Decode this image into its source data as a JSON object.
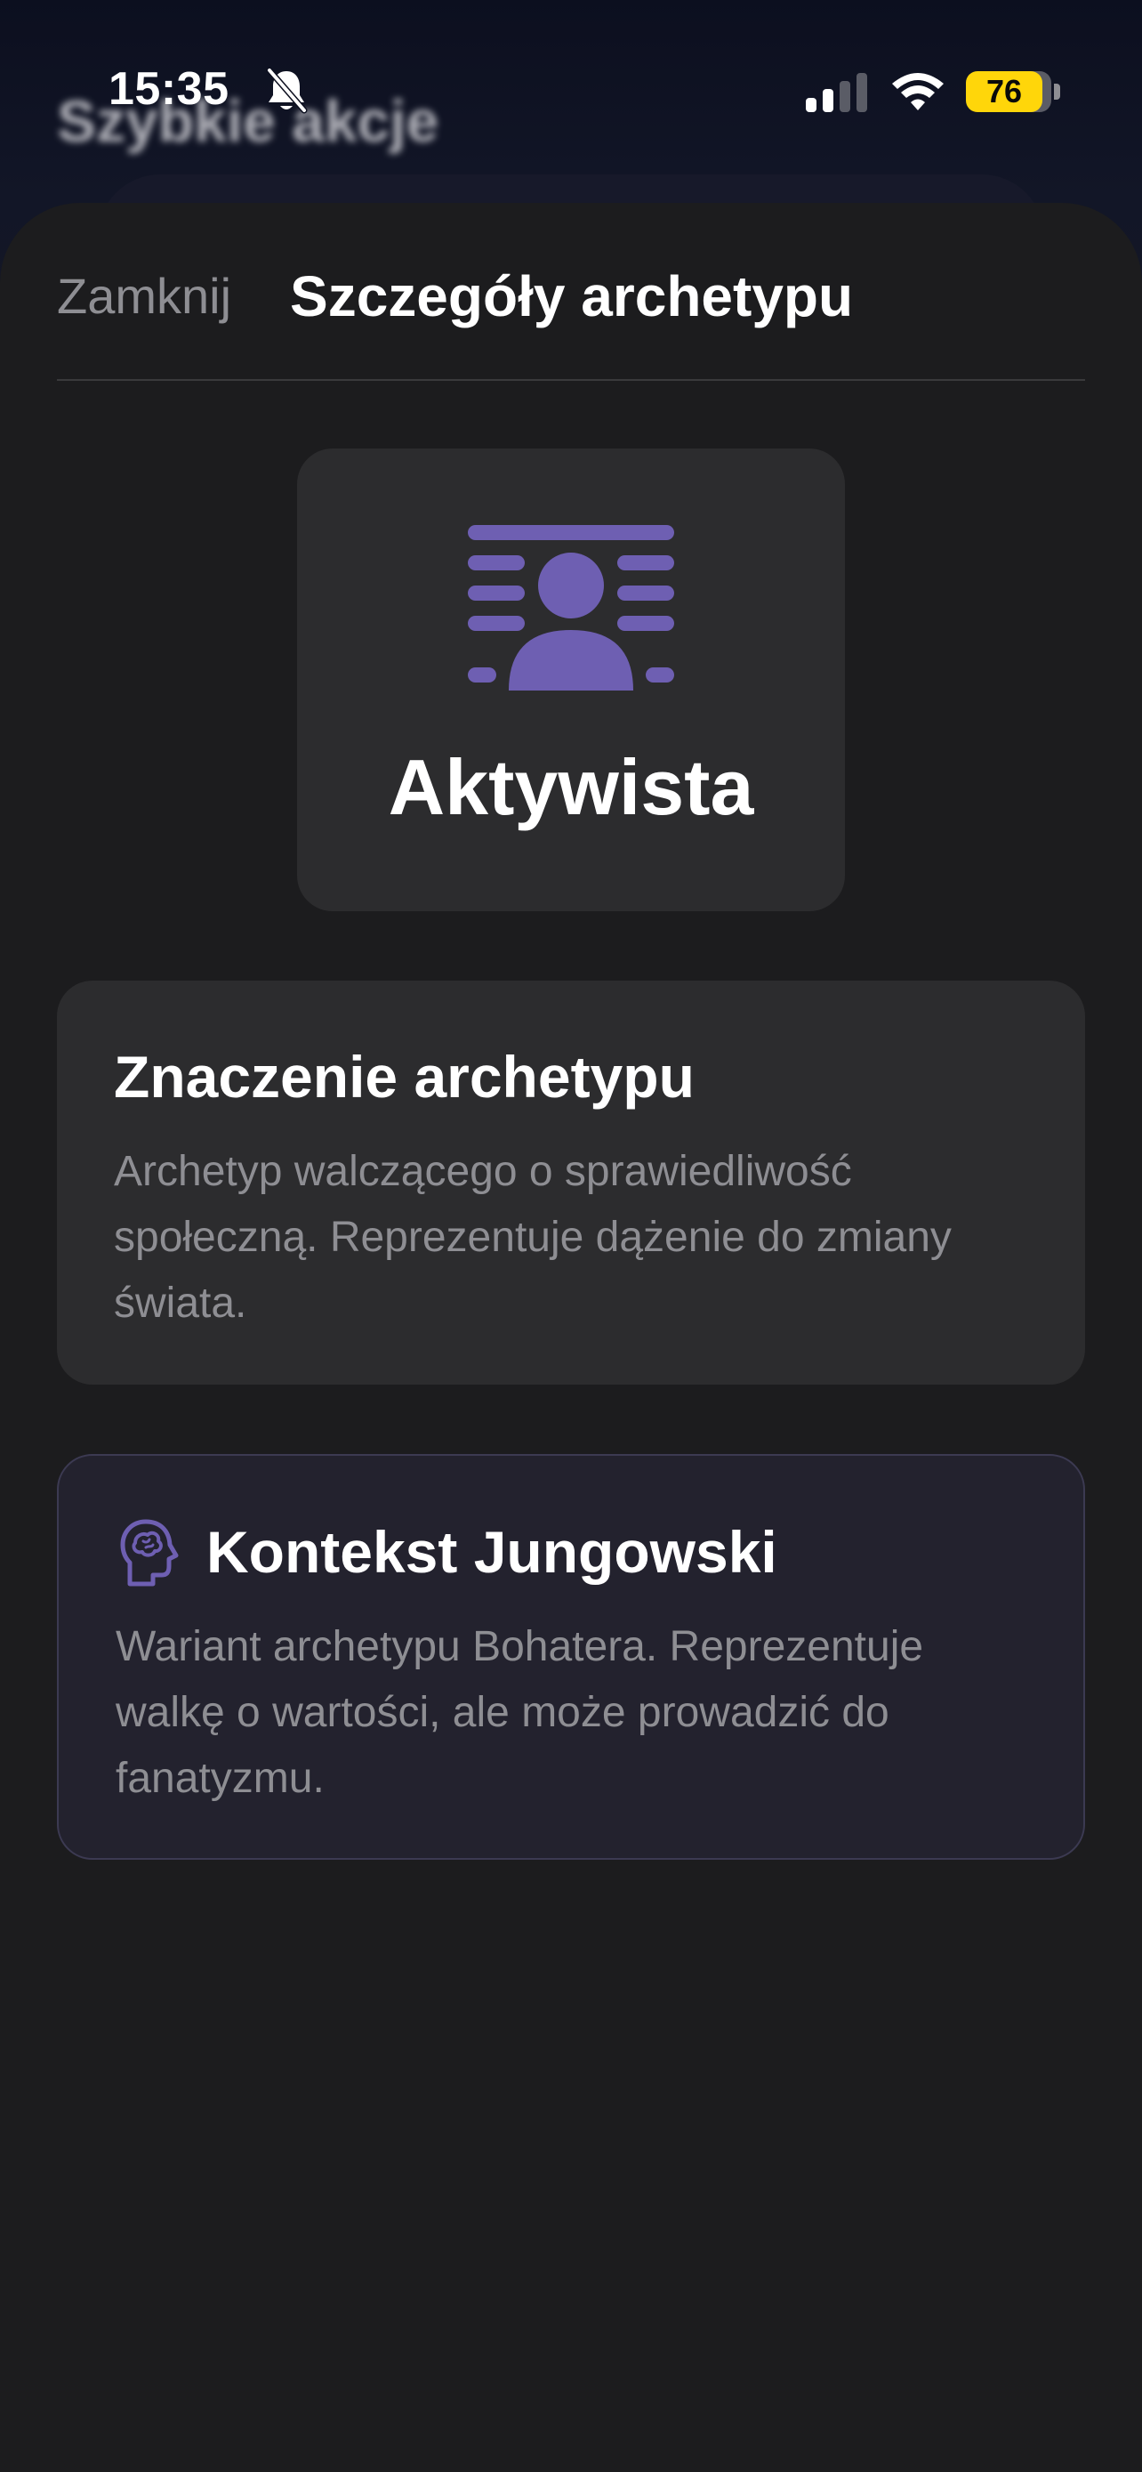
{
  "status_bar": {
    "time": "15:35",
    "battery": "76",
    "icons": [
      "bell-slash-icon",
      "cellular-signal-icon",
      "wifi-icon",
      "battery-icon"
    ]
  },
  "background_page": {
    "title": "Szybkie akcje"
  },
  "sheet": {
    "close_label": "Zamknij",
    "title": "Szczegóły archetypu"
  },
  "archetype": {
    "name": "Aktywista",
    "icon": "person-lines-icon",
    "accent_color": "#6e5fb2"
  },
  "meaning_card": {
    "title": "Znaczenie archetypu",
    "body": "Archetyp walczącego o sprawiedliwość społeczną. Reprezentuje dążenie do zmiany świata."
  },
  "jung_card": {
    "icon": "brain-head-icon",
    "title": "Kontekst Jungowski",
    "body": "Wariant archetypu Bohatera. Reprezentuje walkę o wartości, ale może prowadzić do fanatyzmu."
  }
}
